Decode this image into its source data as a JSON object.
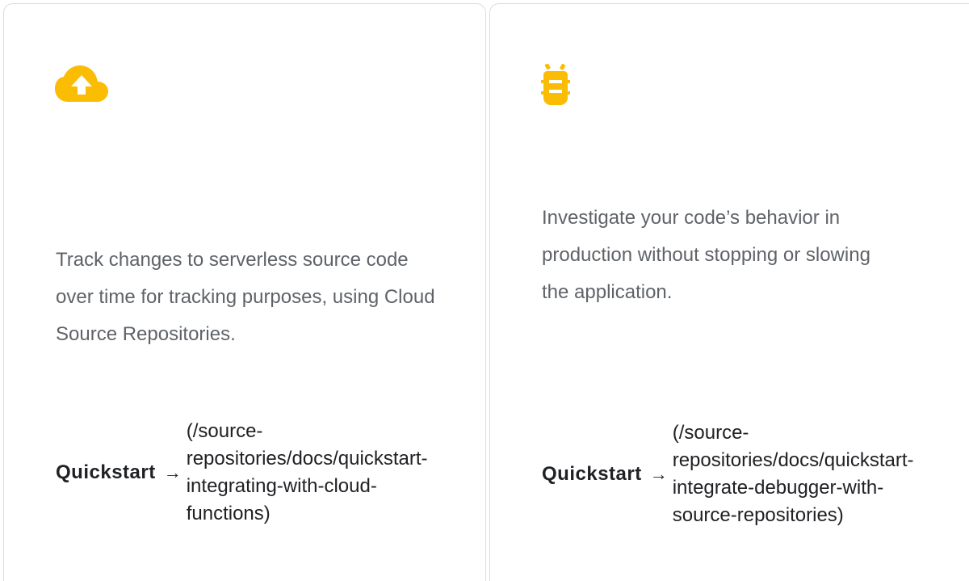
{
  "colors": {
    "accent": "#fbbc04",
    "text": "#202124",
    "muted": "#5f6368",
    "border": "#dadce0"
  },
  "cards": [
    {
      "icon": "cloud-upload-icon",
      "description": "Track changes to serverless source code over time for tracking purposes, using Cloud Source Repositories.",
      "link_label": "Quickstart",
      "link_arrow": "→",
      "link_url_lines": [
        "(/source-",
        "repositories/docs/quickstart-",
        "integrating-with-cloud-",
        "functions)"
      ]
    },
    {
      "icon": "bug-icon",
      "description": "Investigate your code’s behavior in production without stopping or slowing the application.",
      "link_label": "Quickstart",
      "link_arrow": "→",
      "link_url_lines": [
        "(/source-",
        "repositories/docs/quickstart-",
        "integrate-debugger-with-",
        "source-repositories)"
      ]
    }
  ]
}
